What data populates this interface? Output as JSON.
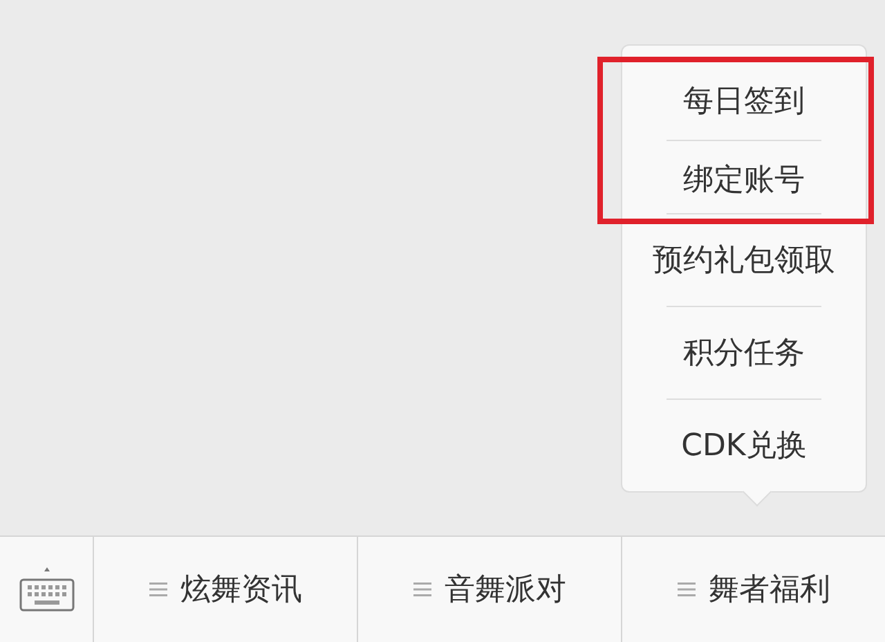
{
  "popup_menu": {
    "items": [
      {
        "label": "每日签到",
        "highlighted": true
      },
      {
        "label": "绑定账号",
        "highlighted": true
      },
      {
        "label": "预约礼包领取",
        "highlighted": false
      },
      {
        "label": "积分任务",
        "highlighted": false
      },
      {
        "label": "CDK兑换",
        "highlighted": false
      }
    ]
  },
  "bottom_menu": {
    "items": [
      {
        "label": "炫舞资讯"
      },
      {
        "label": "音舞派对"
      },
      {
        "label": "舞者福利"
      }
    ]
  }
}
